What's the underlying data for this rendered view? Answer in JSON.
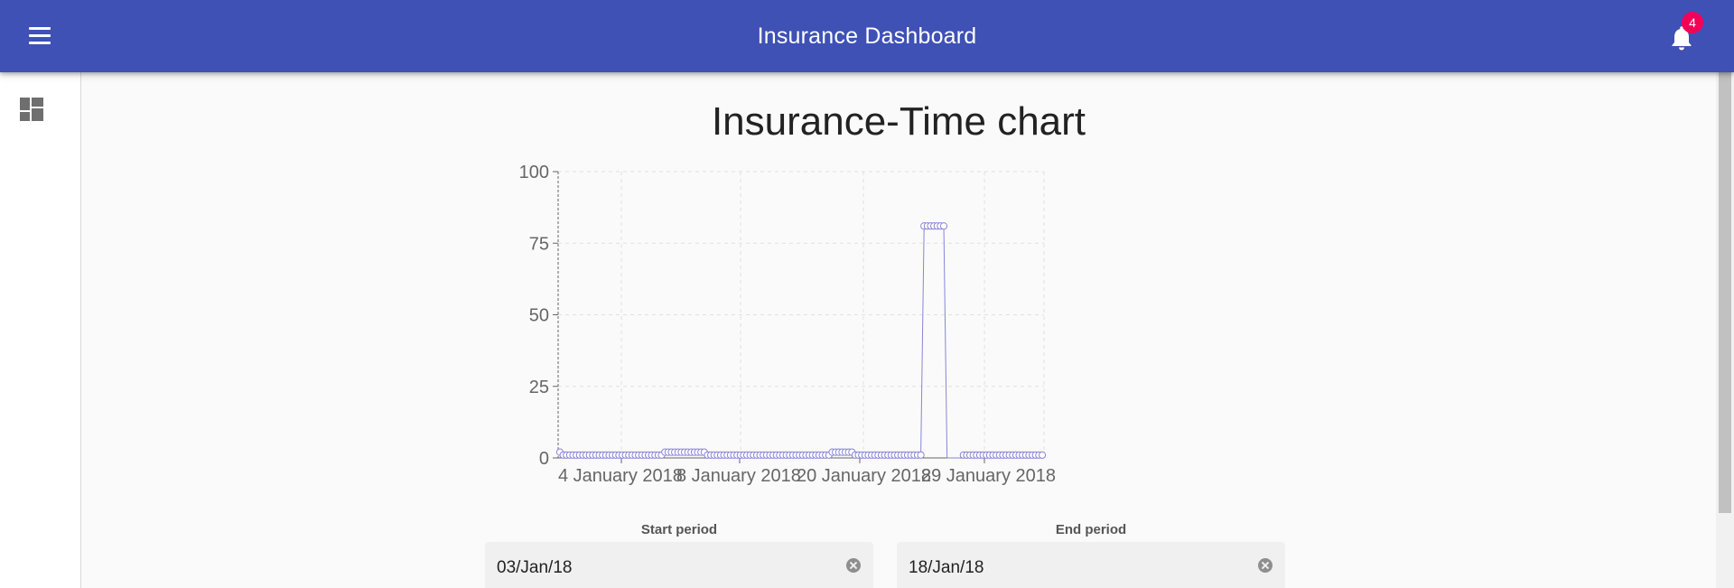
{
  "appbar": {
    "title": "Insurance Dashboard",
    "menu_icon": "hamburger-menu-icon",
    "bell_icon": "notification-bell-icon",
    "notification_count": "4",
    "background": "#3f51b5",
    "badge_color": "#f50057"
  },
  "drawer": {
    "dashboard_icon": "dashboard-icon"
  },
  "chart_data": {
    "type": "line",
    "title": "Insurance-Time chart",
    "xlabel": "",
    "ylabel": "",
    "ylim": [
      0,
      100
    ],
    "y_ticks": [
      "0",
      "25",
      "50",
      "75",
      "100"
    ],
    "x_ticks": [
      "4 January 2018",
      "8 January 2018",
      "20 January 2018",
      "29 January 2018"
    ],
    "grid": true,
    "line_color": "#8884d8",
    "series": [
      {
        "values": [
          2,
          1,
          1,
          1,
          1,
          1,
          1,
          1,
          1,
          1,
          1,
          1,
          1,
          1,
          1,
          1,
          1,
          1,
          1,
          1,
          1,
          1,
          1,
          1,
          1,
          1,
          1,
          1,
          1,
          1,
          1,
          1,
          2,
          2,
          2,
          2,
          2,
          2,
          2,
          2,
          2,
          2,
          2,
          2,
          2,
          1,
          1,
          1,
          1,
          1,
          1,
          1,
          1,
          1,
          1,
          1,
          1,
          1,
          1,
          1,
          1,
          1,
          1,
          1,
          1,
          1,
          1,
          1,
          1,
          1,
          1,
          1,
          1,
          1,
          1,
          1,
          1,
          1,
          1,
          1,
          1,
          1,
          1,
          2,
          2,
          2,
          2,
          2,
          2,
          2,
          1,
          1,
          1,
          1,
          1,
          1,
          1,
          1,
          1,
          1,
          1,
          1,
          1,
          1,
          1,
          1,
          1,
          1,
          1,
          1,
          1,
          81,
          81,
          81,
          81,
          81,
          81,
          81,
          0,
          0,
          0,
          0,
          0,
          1,
          1,
          1,
          1,
          1,
          1,
          1,
          1,
          1,
          1,
          1,
          1,
          1,
          1,
          1,
          1,
          1,
          1,
          1,
          1,
          1,
          1,
          1,
          1,
          1
        ]
      }
    ]
  },
  "filters": {
    "start": {
      "label": "Start period",
      "value": "03/Jan/18"
    },
    "end": {
      "label": "End period",
      "value": "18/Jan/18"
    }
  }
}
